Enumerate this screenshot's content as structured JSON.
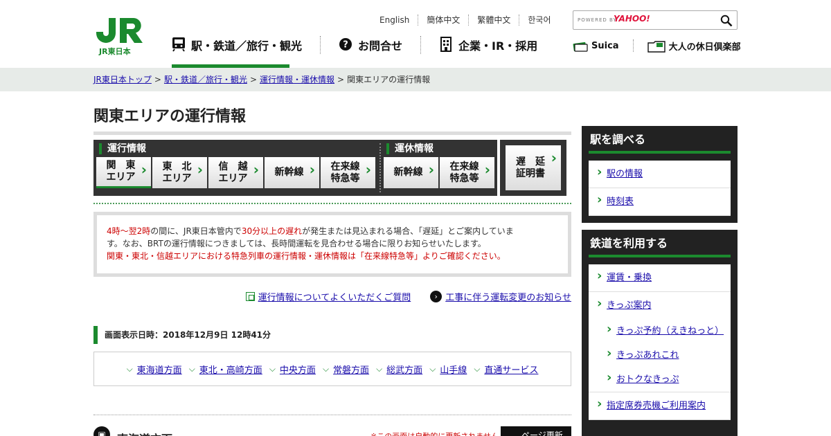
{
  "header": {
    "logo_text": "JR東日本",
    "languages": [
      "English",
      "簡体中文",
      "繁體中文",
      "한국어"
    ],
    "search": {
      "powered_by": "POWERED BY",
      "provider": "YAHOO!",
      "placeholder": ""
    },
    "gnav": [
      {
        "label": "駅・鉄道／旅行・観光",
        "icon": "train-icon",
        "active": true
      },
      {
        "label": "お問合せ",
        "icon": "question-icon"
      },
      {
        "label": "企業・IR・採用",
        "icon": "building-icon"
      }
    ],
    "subnav": [
      {
        "label": "Suica",
        "icon": "suica-card-icon"
      },
      {
        "label": "大人の休日倶楽部",
        "icon": "folder-card-icon"
      }
    ]
  },
  "breadcrumb": {
    "items": [
      "JR東日本トップ",
      "駅・鉄道／旅行・観光",
      "運行情報・運休情報"
    ],
    "current": "関東エリアの運行情報",
    "separator": ">"
  },
  "main": {
    "title": "関東エリアの運行情報",
    "tabs": {
      "operation_header": "運行情報",
      "operation_tabs": [
        {
          "line1": "関　東",
          "line2": "エリア",
          "active": true
        },
        {
          "line1": "東　北",
          "line2": "エリア"
        },
        {
          "line1": "信　越",
          "line2": "エリア"
        },
        {
          "line1": "新幹線",
          "line2": ""
        },
        {
          "line1": "在来線",
          "line2": "特急等"
        }
      ],
      "suspension_header": "運休情報",
      "suspension_tabs": [
        {
          "line1": "新幹線",
          "line2": ""
        },
        {
          "line1": "在来線",
          "line2": "特急等"
        }
      ],
      "delay_cert": {
        "line1": "遅　延",
        "line2": "証明書"
      }
    },
    "notice": {
      "p1_red1": "4時～翌2時",
      "p1_t1": "の間に、JR東日本管内で",
      "p1_red2": "30分以上の遅れ",
      "p1_t2": "が発生または見込まれる場合、「遅延」とご案内していま",
      "p2": "す。なお、BRTの運行情報につきましては、長時間運転を見合わせる場合に限りお知らせいたします。",
      "p3_red": "関東・東北・信越エリアにおける特急列車の運行情報・運休情報は「在来線特急等」よりご確認ください。"
    },
    "links": [
      "運行情報についてよくいただくご質問",
      "工事に伴う運転変更のお知らせ"
    ],
    "timestamp": "画面表示日時：2018年12月9日 12時41分",
    "directions": [
      "東海道方面",
      "東北・高崎方面",
      "中央方面",
      "常磐方面",
      "総武方面",
      "山手線",
      "直通サービス"
    ],
    "section": {
      "title": "東海道方面",
      "warning": "※この画面は自動的に更新されません",
      "refresh_label": "ページ更新"
    }
  },
  "sidebar": {
    "box1": {
      "title": "駅を調べる",
      "items": [
        "駅の情報",
        "時刻表"
      ]
    },
    "box2": {
      "title": "鉄道を利用する",
      "items": [
        "運賃・乗換",
        "きっぷ案内"
      ],
      "subitems": [
        "きっぷ予約（えきねっと）",
        "きっぷあれこれ",
        "おトクなきっぷ"
      ],
      "more": [
        "指定席券売機ご利用案内"
      ]
    }
  },
  "colors": {
    "accent": "#1b8a2e",
    "dark": "#333333",
    "red": "#cc0000",
    "crumb_bg": "#e7ebe8"
  }
}
